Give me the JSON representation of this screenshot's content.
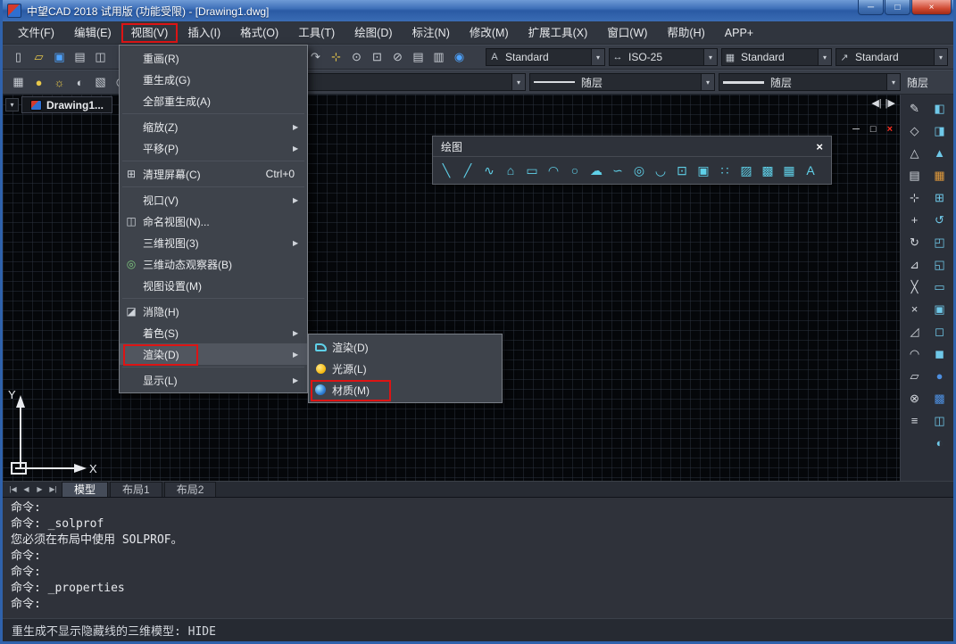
{
  "window": {
    "title": "中望CAD 2018 试用版 (功能受限) - [Drawing1.dwg]"
  },
  "menubar": {
    "items": [
      {
        "label": "文件(F)"
      },
      {
        "label": "编辑(E)"
      },
      {
        "label": "视图(V)"
      },
      {
        "label": "插入(I)"
      },
      {
        "label": "格式(O)"
      },
      {
        "label": "工具(T)"
      },
      {
        "label": "绘图(D)"
      },
      {
        "label": "标注(N)"
      },
      {
        "label": "修改(M)"
      },
      {
        "label": "扩展工具(X)"
      },
      {
        "label": "窗口(W)"
      },
      {
        "label": "帮助(H)"
      },
      {
        "label": "APP+"
      }
    ]
  },
  "toolbar1": {
    "text_style": "Standard",
    "dim_style": "ISO-25",
    "table_style": "Standard",
    "mleader_style": "Standard"
  },
  "toolbar2": {
    "color": "随层",
    "linetype": "随层",
    "lineweight": "随层",
    "plot_style": "随层"
  },
  "doc_tab": {
    "label": "Drawing1..."
  },
  "view_menu": {
    "redraw": "重画(R)",
    "regen": "重生成(G)",
    "regen_all": "全部重生成(A)",
    "zoom": "缩放(Z)",
    "pan": "平移(P)",
    "clean_screen": "清理屏幕(C)",
    "clean_screen_shortcut": "Ctrl+0",
    "viewports": "视口(V)",
    "named_views": "命名视图(N)...",
    "views_3d": "三维视图(3)",
    "orbit": "三维动态观察器(B)",
    "view_settings": "视图设置(M)",
    "hide": "消隐(H)",
    "shade": "着色(S)",
    "render": "渲染(D)",
    "display": "显示(L)"
  },
  "render_submenu": {
    "render": "渲染(D)",
    "light": "光源(L)",
    "material": "材质(M)"
  },
  "draw_toolbar": {
    "title": "绘图"
  },
  "layout_tabs": {
    "model": "模型",
    "layout1": "布局1",
    "layout2": "布局2"
  },
  "command": {
    "lines": [
      "命令:",
      "命令: _solprof",
      "您必须在布局中使用 SOLPROF。",
      "命令:",
      "命令:",
      "命令: _properties",
      "命令:"
    ]
  },
  "status": {
    "message": "重生成不显示隐藏线的三维模型: HIDE"
  },
  "ucs": {
    "x": "X",
    "y": "Y"
  },
  "icons": {
    "minimize": "─",
    "maximize": "□",
    "close": "×",
    "combo-arrow": "▾",
    "submenu-arrow": "▶",
    "tab-menu": "▾",
    "new": "▯",
    "open": "▱",
    "save": "▣",
    "plot": "▤",
    "preview": "◫",
    "redo": "↷",
    "pan": "⊹",
    "zoom": "⊙",
    "zoom-window": "⊡",
    "zoom-prev": "⊘",
    "layer-list": "▤",
    "layer-translate": "▥",
    "help": "◉",
    "layers": "▦",
    "bulb": "●",
    "sun": "☼",
    "layer-prev": "◐",
    "layer-state": "▧",
    "isolate": "◎",
    "lock": "◇",
    "match": "▨",
    "text-style": "A",
    "dim-style": "↔",
    "table-style": "▦",
    "mleader-style": "↗",
    "clean-screen": "⊞",
    "named-views": "◫",
    "orbit": "◎",
    "hide": "◪",
    "nav-first": "|◀",
    "nav-prev": "◀",
    "nav-next": "▶",
    "nav-last": "▶|",
    "nav-split-left": "◀|",
    "nav-split-right": "|▶",
    "line": "╲",
    "xline": "╱",
    "polyline": "∿",
    "polygon": "⌂",
    "rect": "▭",
    "arc": "◠",
    "circle": "○",
    "revcloud": "☁",
    "spline": "∽",
    "ellipse": "◎",
    "ellipse-arc": "◡",
    "insert-block": "⊡",
    "make-block": "▣",
    "point": "∷",
    "hatch": "▨",
    "gradient": "▩",
    "table": "▦",
    "mtext": "A",
    "m1": "✎",
    "m2": "◇",
    "m3": "△",
    "m4": "▤",
    "m5": "⊹",
    "m6": "+",
    "m7": "↻",
    "m8": "⊿",
    "m9": "╳",
    "m10": "×",
    "m11": "◿",
    "m12": "◠",
    "m13": "▱",
    "m14": "⊗",
    "m15": "≡",
    "v1": "◧",
    "v2": "◨",
    "v3": "▲",
    "v4": "▦",
    "v5": "⊞",
    "v6": "↺",
    "v7": "◰",
    "v8": "◱",
    "v9": "▭",
    "v10": "▣",
    "v11": "◻",
    "v12": "◼",
    "v13": "●",
    "v14": "▩",
    "v15": "◫",
    "v16": "◐"
  }
}
